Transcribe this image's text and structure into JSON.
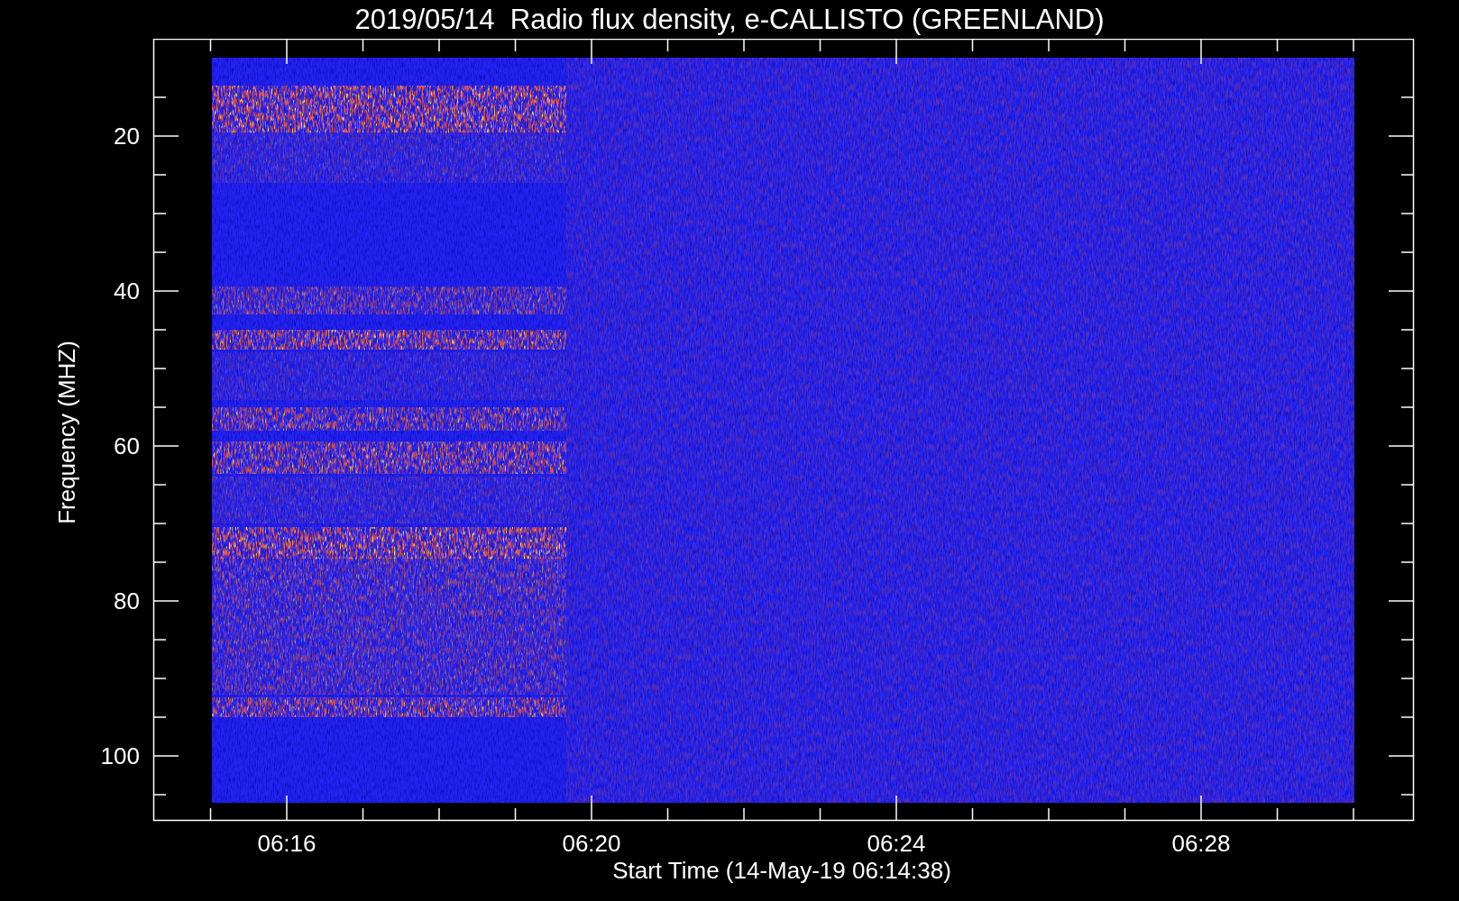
{
  "title": "2019/05/14  Radio flux density, e-CALLISTO (GREENLAND)",
  "plot": {
    "y_axis": {
      "title": "Frequency (MHZ)",
      "tick_labels": [
        "20",
        "40",
        "60",
        "80",
        "100"
      ]
    },
    "x_axis": {
      "title": "Start Time (14-May-19 06:14:38)",
      "tick_labels": [
        "06:16",
        "06:20",
        "06:24",
        "06:28"
      ]
    }
  }
}
